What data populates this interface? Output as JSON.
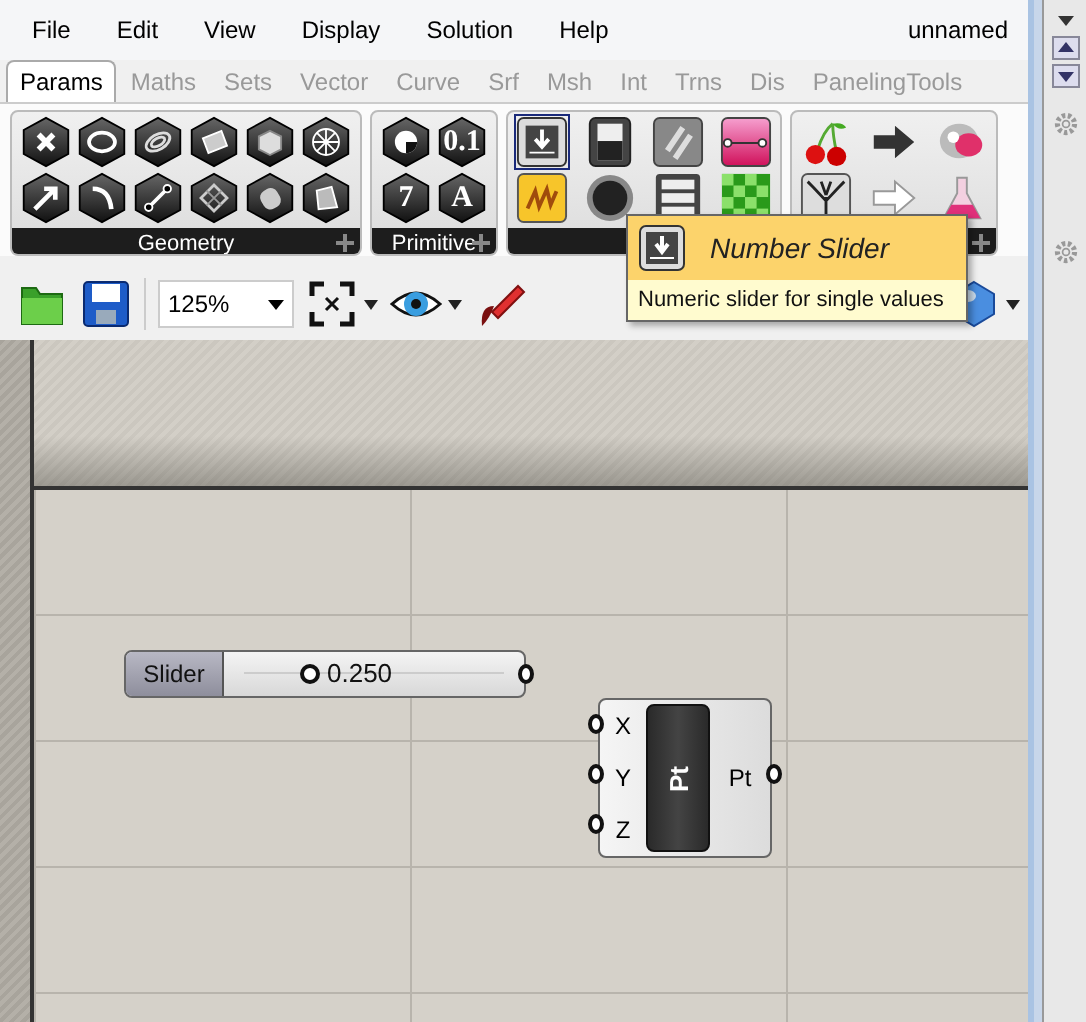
{
  "menu": {
    "items": [
      "File",
      "Edit",
      "View",
      "Display",
      "Solution",
      "Help"
    ],
    "document": "unnamed"
  },
  "tabs": [
    {
      "label": "Params",
      "selected": true
    },
    {
      "label": "Maths",
      "selected": false
    },
    {
      "label": "Sets",
      "selected": false
    },
    {
      "label": "Vector",
      "selected": false
    },
    {
      "label": "Curve",
      "selected": false
    },
    {
      "label": "Srf",
      "selected": false
    },
    {
      "label": "Msh",
      "selected": false
    },
    {
      "label": "Int",
      "selected": false
    },
    {
      "label": "Trns",
      "selected": false
    },
    {
      "label": "Dis",
      "selected": false
    },
    {
      "label": "PanelingTools",
      "selected": false
    }
  ],
  "panels": [
    {
      "kind": "geometry",
      "label": "Geometry"
    },
    {
      "kind": "primitive",
      "label": "Primitive",
      "glyphs": [
        "0.1",
        "7",
        "A"
      ]
    },
    {
      "kind": "input"
    },
    {
      "kind": "util"
    }
  ],
  "toolbar": {
    "zoom": "125%"
  },
  "tooltip": {
    "title": "Number Slider",
    "description": "Numeric slider for single values"
  },
  "canvas": {
    "slider": {
      "label": "Slider",
      "value": "0.250",
      "level": 0.25
    },
    "component": {
      "inputs": [
        "X",
        "Y",
        "Z"
      ],
      "name": "Pt",
      "outputs": [
        "Pt"
      ]
    }
  }
}
